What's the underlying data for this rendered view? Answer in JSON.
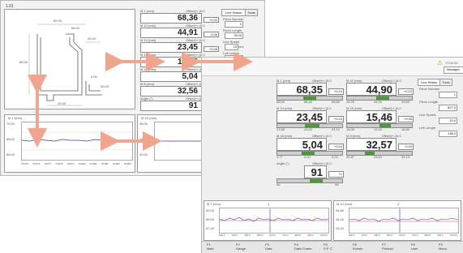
{
  "left_window": {
    "title": "1.01",
    "drawing": {
      "dims": [
        "50.00",
        "40.00",
        "89.00",
        "30.00",
        "20.00",
        "60.00",
        "5.00"
      ]
    },
    "readouts": [
      {
        "label": "M 1 (mm)",
        "offset": "Offset(+/-)0,0",
        "value": "68,36",
        "delta": "+0,02"
      },
      {
        "label": "M 10 (mm)",
        "offset": "Offset(+/-)0,0",
        "value": "44,91",
        "delta": "-0,06"
      },
      {
        "label": "M 14 (mm)",
        "offset": "Offset(+/-)0,0",
        "value": "23,45",
        "delta": "+0,45"
      },
      {
        "label": "M 15 (mm)",
        "offset": "Offset(+/-)0,0",
        "value": "15,45",
        "delta": "-0,06"
      },
      {
        "label": "M 16 (mm)",
        "offset": "Offset(+/-)0,0",
        "value": "5,04",
        "delta": "+0,04"
      },
      {
        "label": "M 8 (mm)",
        "offset": "Offset(+/-)0,0",
        "value": "32,56",
        "delta": "-0,06"
      },
      {
        "label": "Angle (°)",
        "offset": "Offset(+/-)0,0",
        "value": "91",
        "delta": "+1"
      }
    ],
    "tabs": [
      "Line Status",
      "Tools"
    ],
    "status": {
      "piece_number_label": "Piece Number",
      "piece_number": "0",
      "piece_length_label": "Piece Length",
      "piece_length": "78.00",
      "line_speed_label": "Line Speed",
      "line_speed": "15",
      "line_speed_unit": "m/s",
      "left_length_label": "Left Length",
      "left_length": "0"
    },
    "charts": [
      {
        "label": "M 1 (mm)",
        "yticks": [
          "70,00",
          "68,00",
          "66,00"
        ]
      },
      {
        "label": "M 10 (mm)",
        "yticks": [
          "48,00",
          "44,00",
          "40,00"
        ]
      }
    ],
    "x_ticks": [
      "78,875",
      "78,876",
      "78,877",
      "78,878",
      "78,879",
      "78,880",
      "78,881",
      "78,882",
      "78,883",
      "78,884"
    ]
  },
  "right_window": {
    "top_right": {
      "time": "17:01:03",
      "user_button": "Manager"
    },
    "readouts": [
      {
        "label": "M 1 (mm)",
        "offset": "Offset(+/-)0,0",
        "value": "68,35",
        "delta": "+0,13",
        "scale": [
          "68,00",
          "68,40",
          "68,80"
        ],
        "fill": 0.55
      },
      {
        "label": "M 10 (mm)",
        "offset": "Offset(+/-)0,0",
        "value": "44,90",
        "delta": "+0,13",
        "scale": [
          "44,20",
          "44,90",
          "45,60"
        ],
        "fill": 0.55
      },
      {
        "label": "M 14 (mm)",
        "offset": "Offset(+/-)0,0",
        "value": "23,45",
        "delta": "+0,43",
        "scale": [
          "21,88",
          "23,00",
          "24,12"
        ],
        "fill": 0.6
      },
      {
        "label": "M 15 (mm)",
        "offset": "Offset(+/-)0,0",
        "value": "15,46",
        "delta": "+0,05",
        "scale": [
          "14,00",
          "15,40",
          "16,80"
        ],
        "fill": 0.55
      },
      {
        "label": "M 16 (mm)",
        "offset": "Offset(+/-)0,0",
        "value": "5,04",
        "delta": "+0,04",
        "scale": [
          "4,77",
          "5,00",
          "5,23"
        ],
        "fill": 0.5
      },
      {
        "label": "M 8 (mm)",
        "offset": "Offset(+/-)0,0",
        "value": "32,57",
        "delta": "-0,43",
        "scale": [
          "31,87",
          "33,00",
          "34,13"
        ],
        "fill": 0.35
      },
      {
        "label": "Angle (°)",
        "offset": "Offset(+/-)0,0",
        "value": "91",
        "delta": "+1",
        "scale": [
          "86",
          "",
          "96"
        ],
        "fill": 0.55
      }
    ],
    "tabs": [
      "Line Status",
      "Tools"
    ],
    "status": {
      "piece_number_label": "Piece Number",
      "piece_number": "1",
      "piece_length_label": "Piece Length",
      "piece_length": "827,0",
      "line_speed_label": "Line Speed",
      "line_speed": "15,0",
      "left_length_label": "Left Length",
      "left_length": "138,0"
    },
    "charts": [
      {
        "label": "M 1 (mm)",
        "marker": "1",
        "yticks": [
          "69,00",
          "68,00",
          "67,00"
        ]
      },
      {
        "label": "M 10 (mm)",
        "marker": "4",
        "yticks": [
          "44,80",
          "44,00",
          "43,20"
        ]
      }
    ],
    "x_ticks": [
      "200,0",
      "300,0",
      "400,0",
      "500,0",
      "600,0",
      "700,0",
      "800,0",
      "900,0",
      "1000,0"
    ],
    "fkeys": [
      {
        "key": "F1",
        "label": "Main"
      },
      {
        "key": "F2",
        "label": "Gauge"
      },
      {
        "key": "F3",
        "label": "Data"
      },
      {
        "key": "F4",
        "label": "Data Charts"
      },
      {
        "key": "F5",
        "label": "S.P. C"
      },
      {
        "key": "F6",
        "label": "Events"
      },
      {
        "key": "F7",
        "label": "Product"
      },
      {
        "key": "F8",
        "label": "User"
      },
      {
        "key": "F9",
        "label": "Menu"
      }
    ]
  },
  "colors": {
    "arrow": "#f0a58e",
    "bar_green": "#4a9a3a",
    "series_blue": "#3a3ab8",
    "marker_red": "#d04040"
  }
}
